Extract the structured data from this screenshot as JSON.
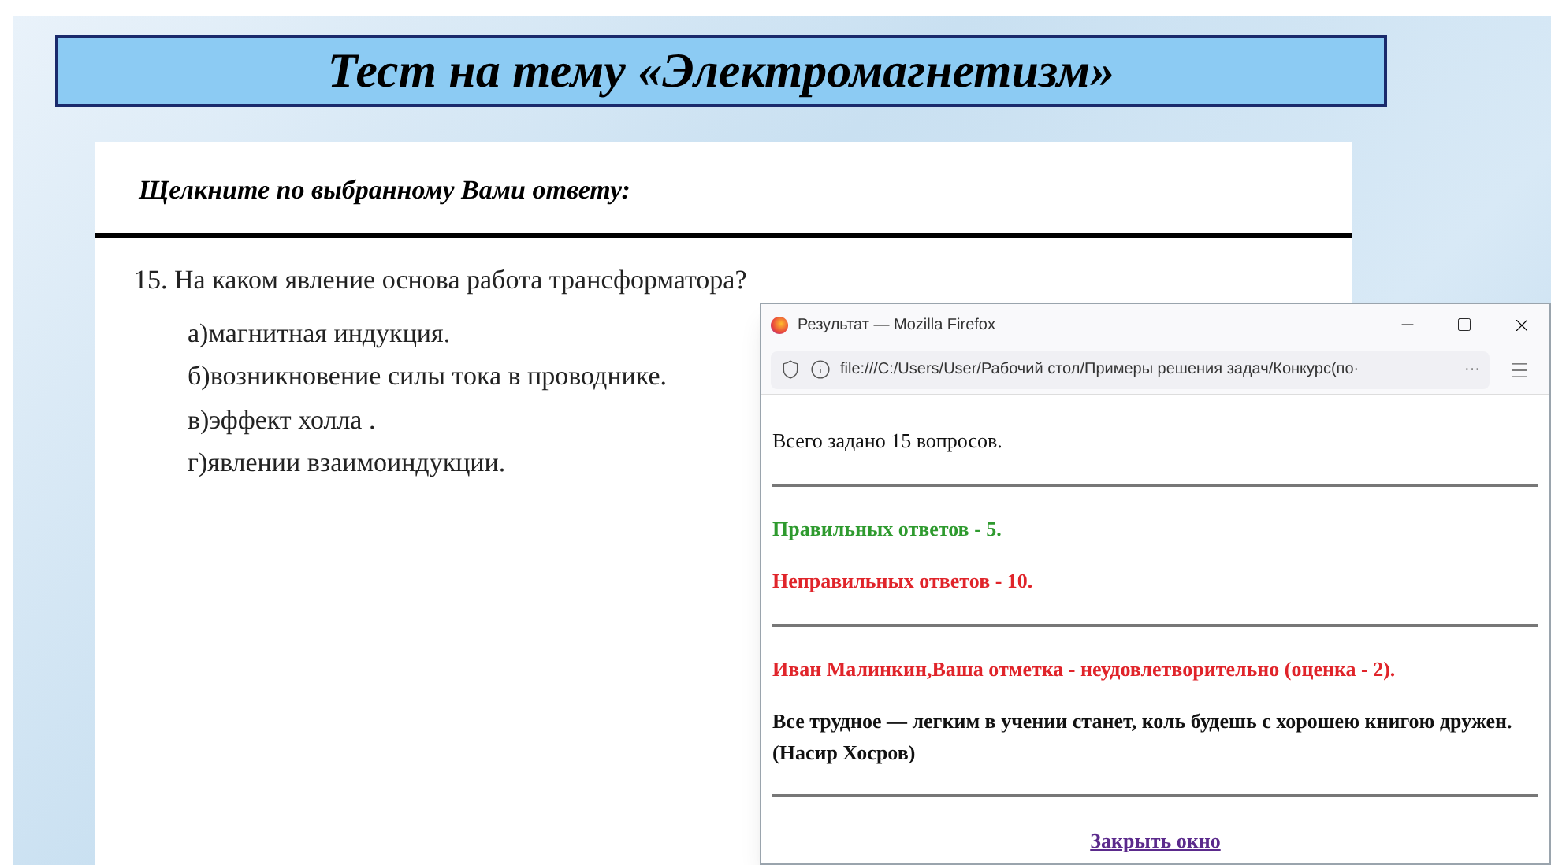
{
  "slide": {
    "title": "Тест на тему «Электромагнетизм»",
    "instruction": "Щелкните по выбранному Вами ответу:",
    "question": "15. На каком явление основа работа трансформатора?",
    "answers": [
      {
        "letter": "а)",
        "text": "магнитная индукция."
      },
      {
        "letter": "б)",
        "text": "возникновение силы тока в проводнике."
      },
      {
        "letter": "в)",
        "text": "эффект холла ."
      },
      {
        "letter": "г)",
        "text": "явлении взаимоиндукции."
      }
    ]
  },
  "browser_window": {
    "title": "Результат — Mozilla Firefox",
    "address": "file:///C:/Users/User/Рабочий стол/Примеры решения задач/Конкурс(по·",
    "more": "···",
    "content": [
      {
        "kind": "text",
        "text": "Всего задано 15 вопросов.",
        "color": "#111111"
      },
      {
        "kind": "rule"
      },
      {
        "kind": "text",
        "text": "Правильных ответов - 5.",
        "color": "#2e9a2e"
      },
      {
        "kind": "text",
        "text": "Неправильных ответов - 10.",
        "color": "#e0242a"
      },
      {
        "kind": "rule"
      },
      {
        "kind": "text",
        "text": "Иван Малинкин,Ваша отметка - неудовлетворительно (оценка - 2).",
        "color": "#e0242a"
      },
      {
        "kind": "text",
        "text": "Все трудное — легким в учении станет, коль будешь с хорошею книгою дружен. (Насир Хосров)",
        "color": "#111111"
      },
      {
        "kind": "rule"
      },
      {
        "kind": "link",
        "text": "Закрыть окно",
        "color": "#5b2a8c"
      }
    ]
  }
}
